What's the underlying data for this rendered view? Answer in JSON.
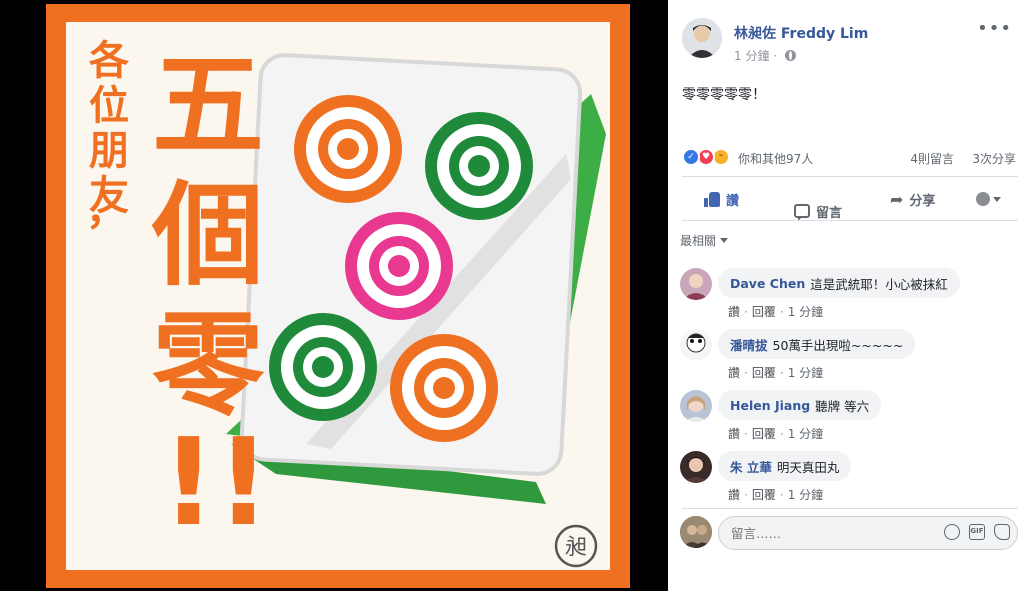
{
  "poster": {
    "side_text_chars": [
      "各",
      "位",
      "朋",
      "友",
      "，"
    ],
    "main_text_chars": [
      "五",
      "個",
      "零",
      "!!"
    ],
    "stamp_char": "昶",
    "colors": {
      "orange": "#f07021",
      "cream": "#fbf6ee",
      "green": "#3dad45",
      "dark_green": "#1f8a3a",
      "pink": "#e8388f",
      "tile_white": "#f4f4f4"
    }
  },
  "post": {
    "author": "林昶佐 Freddy Lim",
    "time": "1 分鐘",
    "text": "零零零零零！",
    "reactions_text": "你和其他97人",
    "comments_count": "4則留言",
    "shares_count": "3次分享",
    "actions": {
      "like": "讚",
      "comment": "留言",
      "share": "分享"
    },
    "sort_label": "最相關"
  },
  "comments": [
    {
      "author": "Dave Chen",
      "text": "這是武統耶！小心被抹紅",
      "like": "讚",
      "reply": "回覆",
      "time": "1 分鐘"
    },
    {
      "author": "潘晴拔",
      "text": "50萬手出現啦~~~~~",
      "like": "讚",
      "reply": "回覆",
      "time": "1 分鐘"
    },
    {
      "author": "Helen Jiang",
      "text": "聽牌 等六",
      "like": "讚",
      "reply": "回覆",
      "time": "1 分鐘"
    },
    {
      "author": "朱 立華",
      "text": "明天真田丸",
      "like": "讚",
      "reply": "回覆",
      "time": "1 分鐘"
    }
  ],
  "composer": {
    "placeholder": "留言……"
  }
}
